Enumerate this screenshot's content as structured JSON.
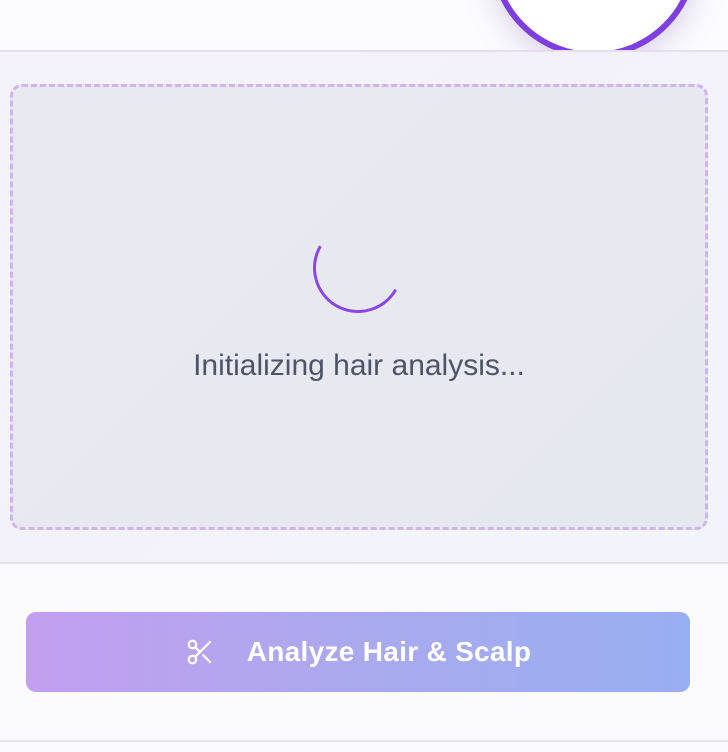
{
  "camera": {
    "status_text": "Initializing hair analysis..."
  },
  "actions": {
    "analyze_label": "Analyze Hair & Scalp",
    "analyze_icon": "scissors-icon"
  },
  "colors": {
    "accent": "#7f3ede",
    "button_gradient_start": "#c39ff0",
    "button_gradient_end": "#98aff1",
    "frame_border": "#cfb4f2"
  }
}
